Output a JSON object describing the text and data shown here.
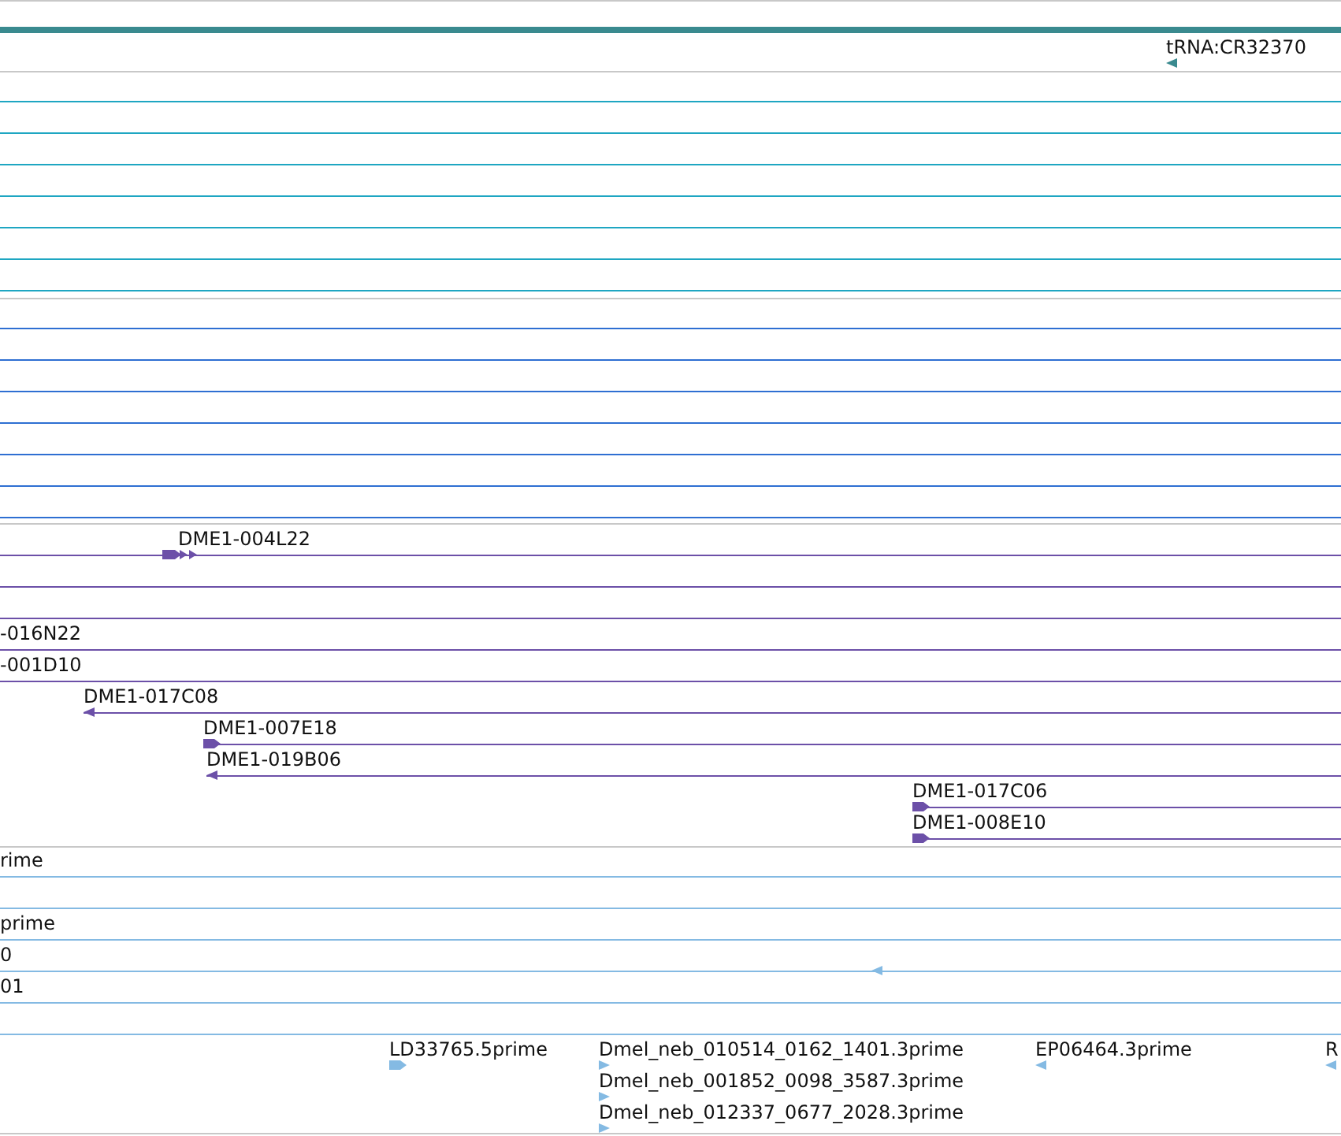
{
  "tracks": [
    {
      "color": "#3a8a8f",
      "rows": [
        {
          "kind": "bar"
        },
        {
          "kind": "marker",
          "label": "tRNA:CR32370",
          "glyph": {
            "kind": "triangle",
            "reverse": true
          }
        }
      ]
    },
    {
      "color": "#1ea6c2",
      "rows": [
        {
          "kind": "line"
        },
        {
          "kind": "line"
        },
        {
          "kind": "line"
        },
        {
          "kind": "line"
        },
        {
          "kind": "line"
        },
        {
          "kind": "line"
        },
        {
          "kind": "line"
        }
      ]
    },
    {
      "color": "#2e6fd2",
      "rows": [
        {
          "kind": "line"
        },
        {
          "kind": "line"
        },
        {
          "kind": "line"
        },
        {
          "kind": "line"
        },
        {
          "kind": "line"
        },
        {
          "kind": "line"
        },
        {
          "kind": "line"
        }
      ]
    },
    {
      "color": "#6c50a8",
      "rows": [
        {
          "kind": "feature",
          "label": "DME1-004L22",
          "glyph": {
            "kind": "multi",
            "reverse": false
          }
        },
        {
          "kind": "line"
        },
        {
          "kind": "line"
        },
        {
          "kind": "feature",
          "label": "-016N22"
        },
        {
          "kind": "feature",
          "label": "-001D10"
        },
        {
          "kind": "feature",
          "label": "DME1-017C08",
          "glyph": {
            "kind": "triangle",
            "reverse": true
          }
        },
        {
          "kind": "feature",
          "label": "DME1-007E18",
          "glyph": {
            "kind": "flag",
            "reverse": false
          }
        },
        {
          "kind": "feature",
          "label": "DME1-019B06",
          "glyph": {
            "kind": "triangle",
            "reverse": true
          }
        },
        {
          "kind": "feature",
          "label": "DME1-017C06",
          "glyph": {
            "kind": "flag",
            "reverse": false
          }
        },
        {
          "kind": "feature",
          "label": "DME1-008E10",
          "glyph": {
            "kind": "flag",
            "reverse": false
          }
        }
      ]
    },
    {
      "color": "#84bae3",
      "rows": [
        {
          "kind": "feature",
          "label": "rime"
        },
        {
          "kind": "line"
        },
        {
          "kind": "feature",
          "label": "prime"
        },
        {
          "kind": "feature",
          "label": "0",
          "glyph": {
            "kind": "triangle",
            "reverse": true
          }
        },
        {
          "kind": "feature",
          "label": "01"
        },
        {
          "kind": "line"
        },
        {
          "kind": "marker",
          "label": "LD33765.5prime",
          "glyph": {
            "kind": "flag",
            "reverse": false
          }
        },
        {
          "kind": "marker",
          "label": "Dmel_neb_010514_0162_1401.3prime",
          "glyph": {
            "kind": "triangle",
            "reverse": false
          }
        },
        {
          "kind": "marker",
          "label": "EP06464.3prime",
          "glyph": {
            "kind": "triangle",
            "reverse": true
          }
        },
        {
          "kind": "marker",
          "label": "R",
          "glyph": {
            "kind": "triangle",
            "reverse": true
          }
        },
        {
          "kind": "marker",
          "label": "Dmel_neb_001852_0098_3587.3prime",
          "glyph": {
            "kind": "triangle",
            "reverse": false
          }
        },
        {
          "kind": "marker",
          "label": "Dmel_neb_012337_0677_2028.3prime",
          "glyph": {
            "kind": "triangle",
            "reverse": false
          }
        }
      ]
    }
  ]
}
